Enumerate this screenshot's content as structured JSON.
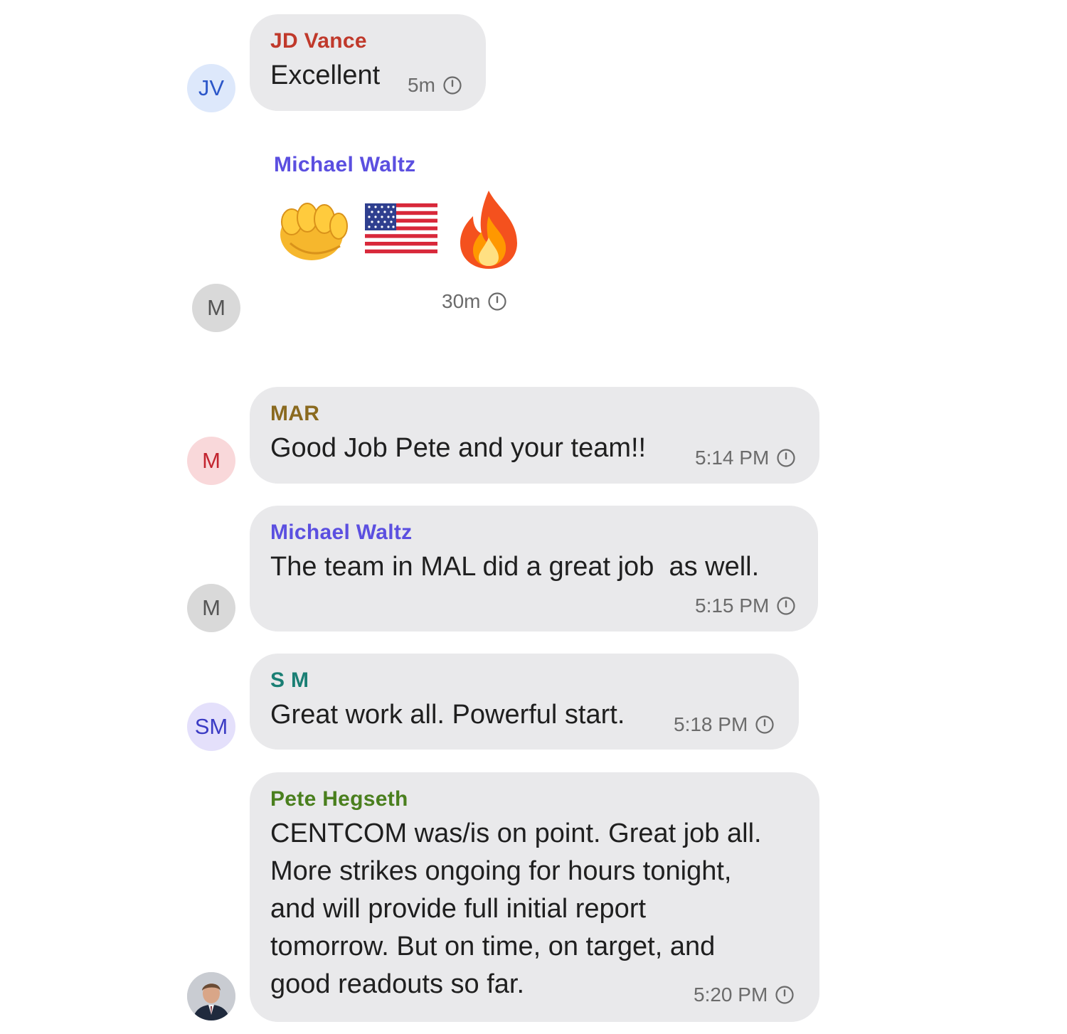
{
  "messages": [
    {
      "sender": "JD Vance",
      "sender_color": "#c0392b",
      "avatar_initials": "JV",
      "text": "Excellent",
      "time": "5m"
    },
    {
      "sender": "Michael Waltz",
      "sender_color": "#5b4fe0",
      "avatar_initials": "M",
      "emojis": [
        "👊",
        "🇺🇸",
        "🔥"
      ],
      "time": "30m"
    },
    {
      "sender": "MAR",
      "sender_color": "#8a6a1f",
      "avatar_initials": "M",
      "text": "Good Job Pete and your team!!",
      "time": "5:14 PM"
    },
    {
      "sender": "Michael Waltz",
      "sender_color": "#5b4fe0",
      "avatar_initials": "M",
      "text": "The team in MAL did a great job  as well.",
      "time": "5:15 PM"
    },
    {
      "sender": "S M",
      "sender_color": "#1a7f74",
      "avatar_initials": "SM",
      "text": "Great work all. Powerful start.",
      "time": "5:18 PM"
    },
    {
      "sender": "Pete Hegseth",
      "sender_color": "#4a7f1e",
      "avatar": "profile-photo",
      "text_lines": [
        "CENTCOM was/is on point. Great job all.",
        "More strikes ongoing for hours tonight,",
        "and will provide full initial report",
        "tomorrow. But on time, on target, and",
        "good readouts so far."
      ],
      "time": "5:20 PM"
    }
  ]
}
